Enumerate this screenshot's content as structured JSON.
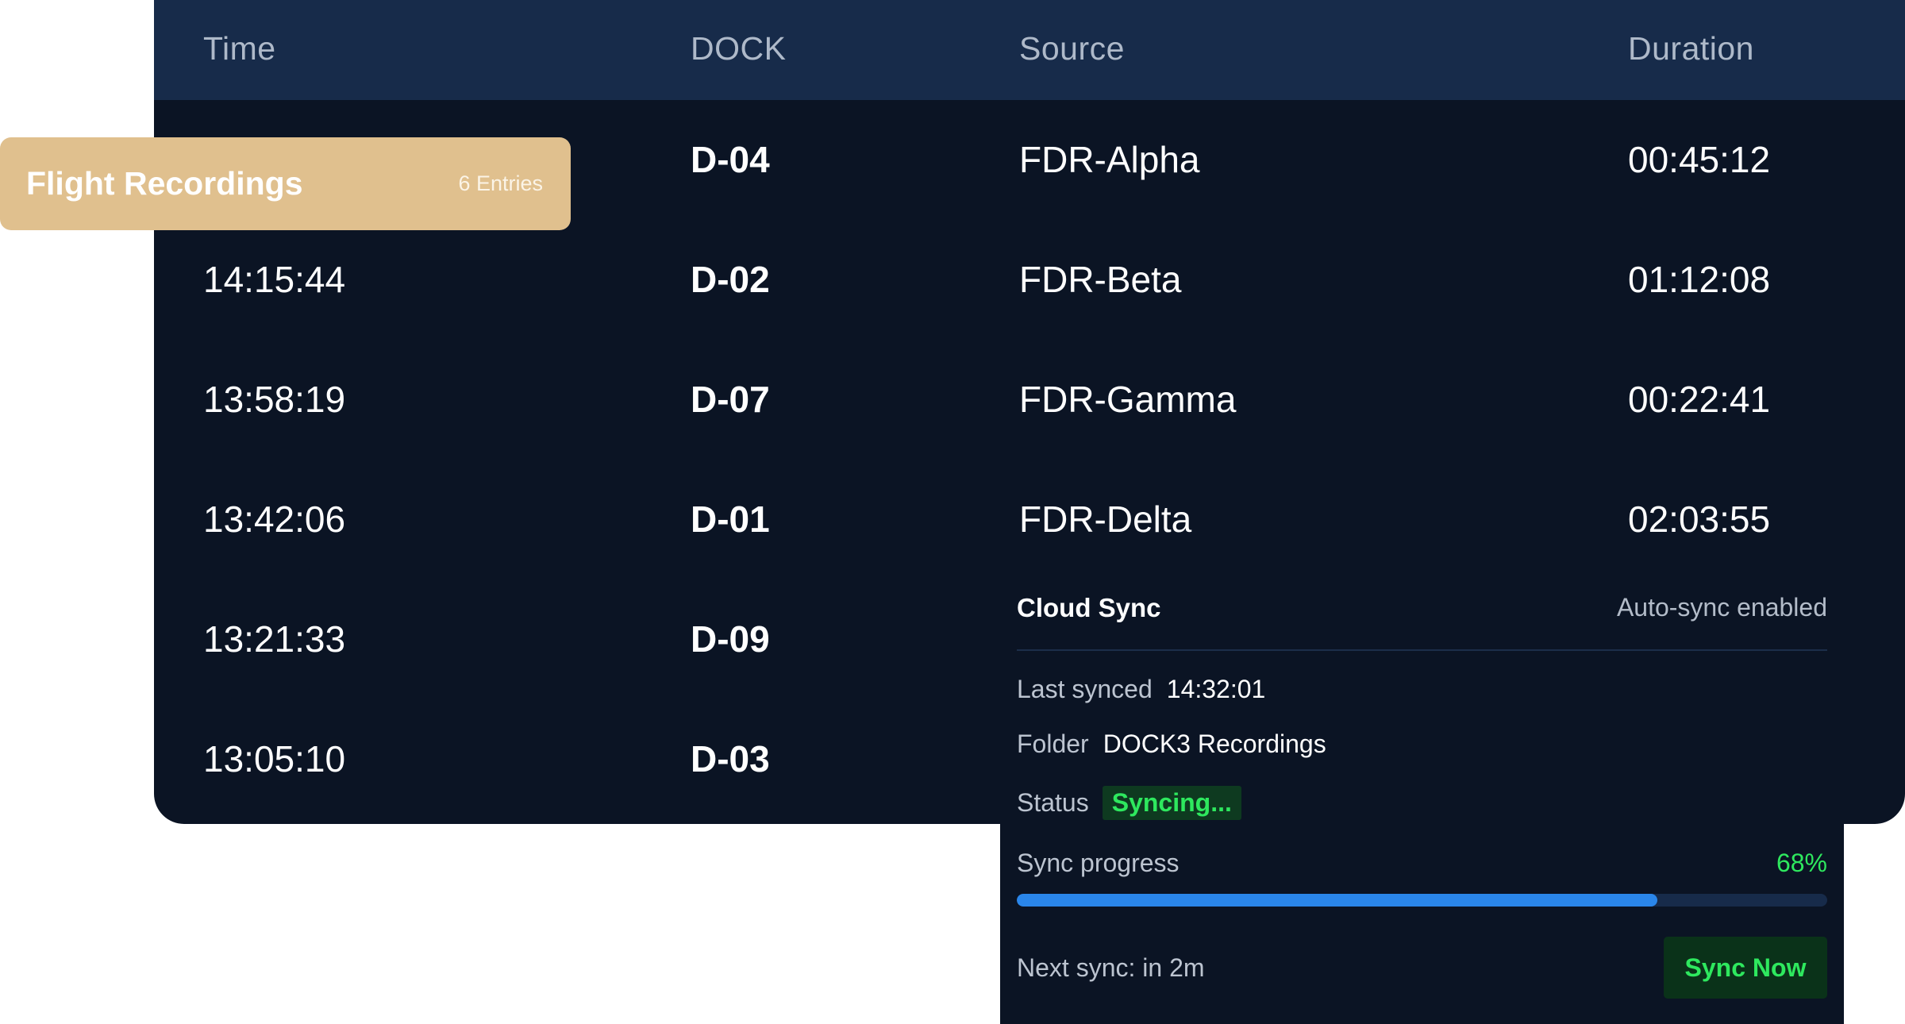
{
  "table": {
    "headers": {
      "time": "Time",
      "dock": "DOCK",
      "source": "Source",
      "duration": "Duration"
    },
    "rows": [
      {
        "time": "",
        "dock": "D-04",
        "source": "FDR-Alpha",
        "duration": "00:45:12"
      },
      {
        "time": "14:15:44",
        "dock": "D-02",
        "source": "FDR-Beta",
        "duration": "01:12:08"
      },
      {
        "time": "13:58:19",
        "dock": "D-07",
        "source": "FDR-Gamma",
        "duration": "00:22:41"
      },
      {
        "time": "13:42:06",
        "dock": "D-01",
        "source": "FDR-Delta",
        "duration": "02:03:55"
      },
      {
        "time": "13:21:33",
        "dock": "D-09",
        "source": "",
        "duration": ""
      },
      {
        "time": "13:05:10",
        "dock": "D-03",
        "source": "",
        "duration": ""
      }
    ]
  },
  "badge": {
    "title": "Flight Recordings",
    "count": "6 Entries"
  },
  "sync": {
    "title": "Cloud Sync",
    "auto": "Auto-sync enabled",
    "last_synced_label": "Last synced",
    "last_synced_value": "14:32:01",
    "folder_label": "Folder",
    "folder_value": "DOCK3 Recordings",
    "status_label": "Status",
    "status_value": "Syncing...",
    "progress_label": "Sync progress",
    "progress_text": "68%",
    "progress_fraction": 0.79,
    "next_sync": "Next sync: in 2m",
    "button_label": "Sync Now"
  },
  "colors": {
    "table_bg": "#0b1424",
    "header_bg": "#172b4a",
    "badge_bg": "#e0c08e",
    "accent_green": "#2ee85e",
    "progress_blue": "#2a86ea"
  }
}
